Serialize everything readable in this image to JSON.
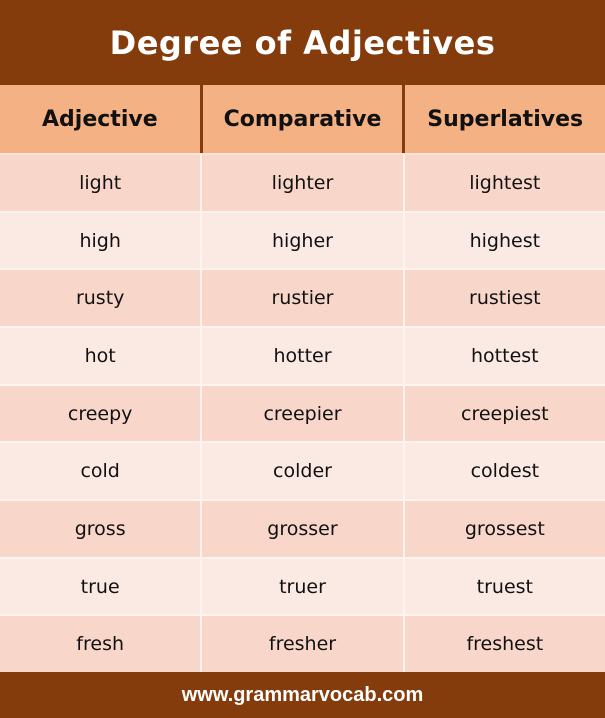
{
  "title": "Degree of Adjectives",
  "columns": [
    "Adjective",
    "Comparative",
    "Superlatives"
  ],
  "rows": [
    [
      "light",
      "lighter",
      "lightest"
    ],
    [
      "high",
      "higher",
      "highest"
    ],
    [
      "rusty",
      "rustier",
      "rustiest"
    ],
    [
      "hot",
      "hotter",
      "hottest"
    ],
    [
      "creepy",
      "creepier",
      "creepiest"
    ],
    [
      "cold",
      "colder",
      "coldest"
    ],
    [
      "gross",
      "grosser",
      "grossest"
    ],
    [
      "true",
      "truer",
      "truest"
    ],
    [
      "fresh",
      "fresher",
      "freshest"
    ]
  ],
  "footer": "www.grammarvocab.com",
  "colors": {
    "brand": "#843c0c",
    "header": "#f4b183",
    "row_dark": "#f8d7ca",
    "row_light": "#fbe9e4"
  }
}
